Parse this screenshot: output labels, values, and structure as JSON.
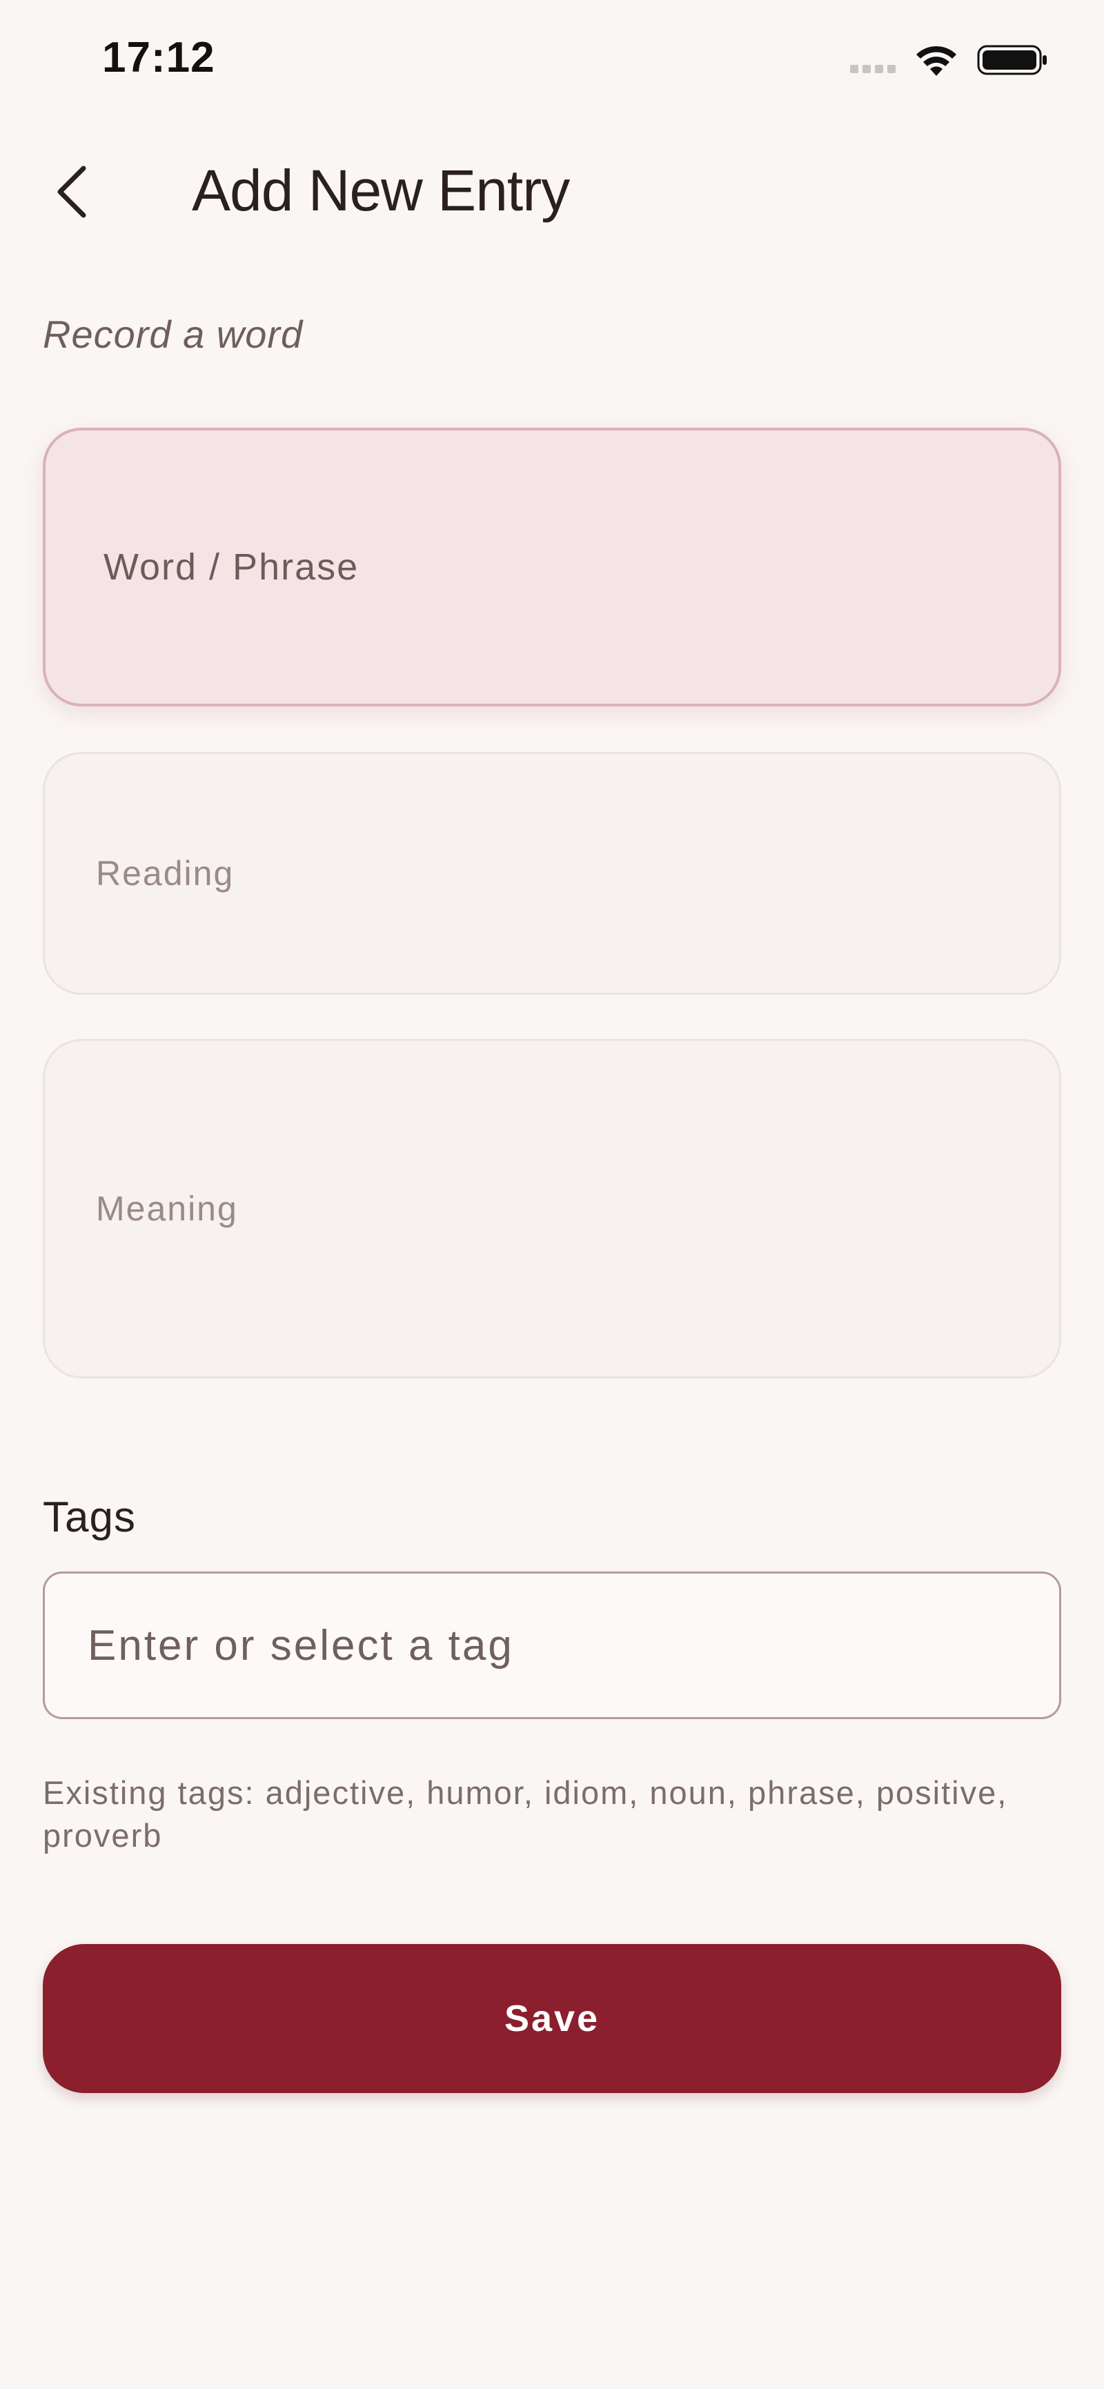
{
  "status_bar": {
    "time": "17:12",
    "icons": [
      "signal-icon",
      "wifi-icon",
      "battery-icon"
    ]
  },
  "header": {
    "back_icon": "chevron-left-icon",
    "title": "Add New Entry"
  },
  "subtitle": "Record a word",
  "fields": {
    "word": {
      "placeholder": "Word / Phrase",
      "value": ""
    },
    "reading": {
      "placeholder": "Reading",
      "value": ""
    },
    "meaning": {
      "placeholder": "Meaning",
      "value": ""
    }
  },
  "tags": {
    "label": "Tags",
    "input_placeholder": "Enter or select a tag",
    "existing_text": "Existing tags: adjective, humor, idiom, noun, phrase, positive, proverb"
  },
  "actions": {
    "save_label": "Save"
  },
  "colors": {
    "background": "#faf6f4",
    "accent": "#8b1f2d",
    "active_field_bg": "#f5e4e6",
    "active_field_border": "#dbb1b8"
  }
}
